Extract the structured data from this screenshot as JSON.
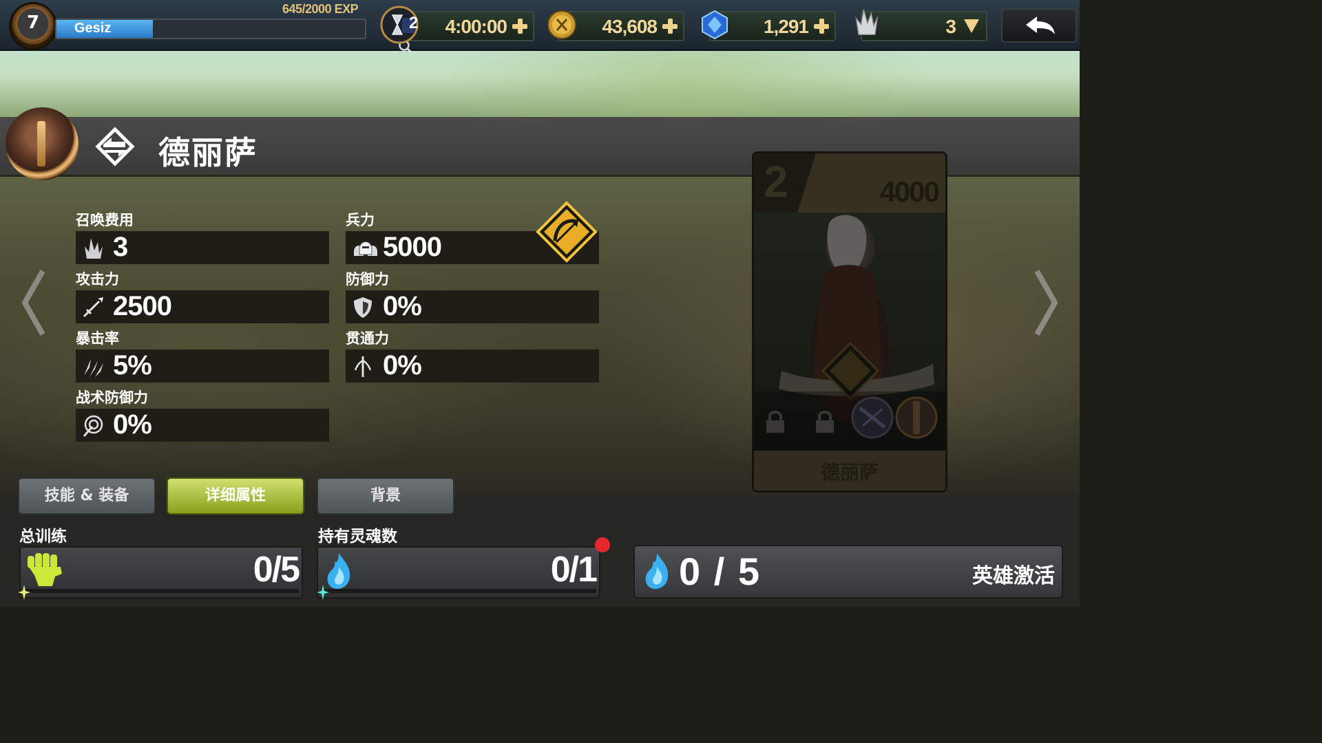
{
  "topbar": {
    "level": "7",
    "player_name": "Gesiz",
    "exp": "645/2000 EXP",
    "exp_progress": 0.3225,
    "timer_badge": "2",
    "timer": "4:00:00",
    "gold": "43,608",
    "gems": "1,291",
    "crystals": "3"
  },
  "hero": {
    "name": "德丽萨"
  },
  "stats": {
    "summon_cost_label": "召唤费用",
    "summon_cost": "3",
    "troops_label": "兵力",
    "troops": "5000",
    "attack_label": "攻击力",
    "attack": "2500",
    "defense_label": "防御力",
    "defense": "0%",
    "crit_label": "暴击率",
    "crit": "5%",
    "penetration_label": "贯通力",
    "penetration": "0%",
    "tactical_defense_label": "战术防御力",
    "tactical_defense": "0%"
  },
  "card": {
    "cost": "2",
    "troops": "4000",
    "name": "德丽萨"
  },
  "tabs": [
    {
      "label": "技能 & 装备",
      "active": false
    },
    {
      "label": "详细属性",
      "active": true
    },
    {
      "label": "背景",
      "active": false
    }
  ],
  "bottom": {
    "training_label": "总训练",
    "training_value": "0/5",
    "souls_label": "持有灵魂数",
    "souls_value": "0/1",
    "activate_value": "0 / 5",
    "activate_label": "英雄激活"
  },
  "colors": {
    "accent_gold": "#f2d79a",
    "active_tab": "#a8c030",
    "notification": "#e8262e"
  }
}
